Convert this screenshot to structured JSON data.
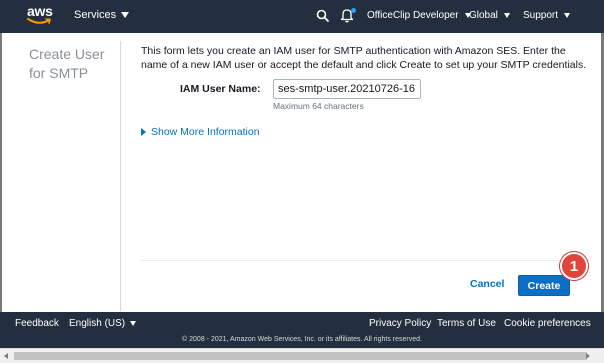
{
  "header": {
    "logo": "aws",
    "services_label": "Services",
    "account_label": "OfficeClip Developer",
    "region_label": "Global",
    "support_label": "Support",
    "icons": [
      "search-icon",
      "bell-icon"
    ]
  },
  "sidebar": {
    "title": "Create User for SMTP"
  },
  "form": {
    "intro": "This form lets you create an IAM user for SMTP authentication with Amazon SES. Enter the name of a new IAM user or accept the default and click Create to set up your SMTP credentials.",
    "iam_label": "IAM User Name:",
    "iam_value": "ses-smtp-user.20210726-16",
    "iam_hint": "Maximum 64 characters",
    "more_info": "Show More Information"
  },
  "actions": {
    "cancel": "Cancel",
    "create": "Create",
    "step_badge": "1"
  },
  "footer": {
    "feedback": "Feedback",
    "language": "English (US)",
    "privacy": "Privacy Policy",
    "terms": "Terms of Use",
    "cookies": "Cookie preferences",
    "copyright": "© 2008 - 2021, Amazon Web Services, Inc. or its affiliates. All rights reserved."
  },
  "colors": {
    "nav_bg": "#232f3e",
    "link": "#0073bb",
    "primary_button": "#0b6fc6",
    "badge": "#e0463b"
  }
}
